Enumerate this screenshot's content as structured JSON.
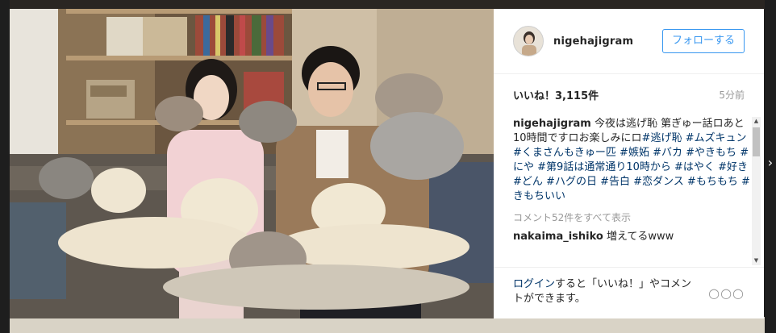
{
  "post": {
    "username": "nigehajigram",
    "follow_label": "フォローする",
    "likes": "いいね！3,115件",
    "time": "5分前",
    "caption": {
      "user": "nigehajigram",
      "text_parts": [
        {
          "type": "text",
          "value": " 今夜は逃げ恥 第ぎゅー話ロあと10時間ですロお楽しみにロ"
        },
        {
          "type": "tag",
          "value": "#逃げ恥"
        },
        {
          "type": "text",
          "value": " "
        },
        {
          "type": "tag",
          "value": "#ムズキュン"
        },
        {
          "type": "text",
          "value": " "
        },
        {
          "type": "tag",
          "value": "#くまさんもきゅー匹"
        },
        {
          "type": "text",
          "value": " "
        },
        {
          "type": "tag",
          "value": "#嫉妬"
        },
        {
          "type": "text",
          "value": " "
        },
        {
          "type": "tag",
          "value": "#バカ"
        },
        {
          "type": "text",
          "value": " "
        },
        {
          "type": "tag",
          "value": "#やきもち"
        },
        {
          "type": "text",
          "value": " "
        },
        {
          "type": "tag",
          "value": "#にや"
        },
        {
          "type": "text",
          "value": " "
        },
        {
          "type": "tag",
          "value": "#第9話は通常通り10時から"
        },
        {
          "type": "text",
          "value": " "
        },
        {
          "type": "tag",
          "value": "#はやく"
        },
        {
          "type": "text",
          "value": " "
        },
        {
          "type": "tag",
          "value": "#好き"
        },
        {
          "type": "text",
          "value": " "
        },
        {
          "type": "tag",
          "value": "#どん"
        },
        {
          "type": "text",
          "value": " "
        },
        {
          "type": "tag",
          "value": "#ハグの日"
        },
        {
          "type": "text",
          "value": " "
        },
        {
          "type": "tag",
          "value": "#告白"
        },
        {
          "type": "text",
          "value": " "
        },
        {
          "type": "tag",
          "value": "#恋ダンス"
        },
        {
          "type": "text",
          "value": " "
        },
        {
          "type": "tag",
          "value": "#もちもち"
        },
        {
          "type": "text",
          "value": " "
        },
        {
          "type": "tag",
          "value": "#きもちいい"
        }
      ]
    },
    "view_all": "コメント52件をすべて表示",
    "comments": [
      {
        "user": "nakaima_ishiko",
        "text": "増えてるwww"
      }
    ],
    "footer": {
      "login_link": "ログイン",
      "login_rest": "すると「いいね！」やコメントができます。",
      "more": "○○○"
    },
    "side_arrow": "›"
  },
  "colors": {
    "link": "#003569",
    "follow": "#3897f0",
    "muted": "#999999"
  },
  "icons": {
    "more": "more-options-icon",
    "scroll_up": "scroll-up-arrow-icon",
    "scroll_down": "scroll-down-arrow-icon"
  }
}
